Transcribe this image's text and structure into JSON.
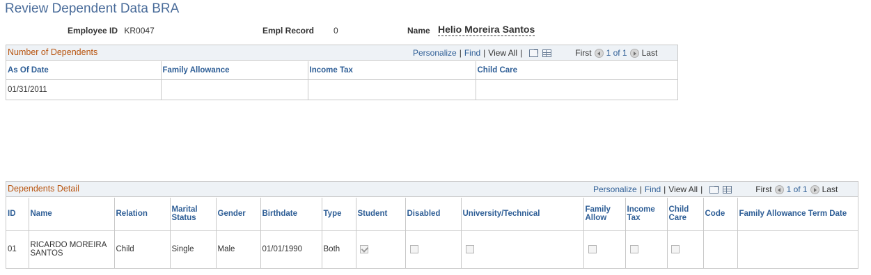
{
  "page": {
    "title": "Review Dependent Data BRA"
  },
  "header": {
    "employee_id_label": "Employee ID",
    "employee_id": "KR0047",
    "empl_record_label": "Empl Record",
    "empl_record": "0",
    "name_label": "Name",
    "name": "Helio Moreira Santos"
  },
  "dependents_count": {
    "title": "Number of Dependents",
    "nav": {
      "personalize": "Personalize",
      "find": "Find",
      "view_all": "View All",
      "first": "First",
      "range": "1 of 1",
      "last": "Last"
    },
    "columns": [
      "As Of Date",
      "Family Allowance",
      "Income Tax",
      "Child Care"
    ],
    "rows": [
      {
        "as_of_date": "01/31/2011",
        "family_allowance": "",
        "income_tax": "",
        "child_care": ""
      }
    ]
  },
  "dependents_detail": {
    "title": "Dependents Detail",
    "nav": {
      "personalize": "Personalize",
      "find": "Find",
      "view_all": "View All",
      "first": "First",
      "range": "1 of 1",
      "last": "Last"
    },
    "columns": {
      "id": "ID",
      "name": "Name",
      "relation": "Relation",
      "marital_status_1": "Marital",
      "marital_status_2": "Status",
      "gender": "Gender",
      "birthdate": "Birthdate",
      "type": "Type",
      "student": "Student",
      "disabled": "Disabled",
      "university": "University/Technical",
      "family_allow_1": "Family",
      "family_allow_2": "Allow",
      "income_tax_1": "Income",
      "income_tax_2": "Tax",
      "child_care_1": "Child",
      "child_care_2": "Care",
      "code": "Code",
      "family_allowance_term_date": "Family Allowance Term Date"
    },
    "rows": [
      {
        "id": "01",
        "name_1": "RICARDO MOREIRA",
        "name_2": "SANTOS",
        "relation": "Child",
        "marital_status": "Single",
        "gender": "Male",
        "birthdate": "01/01/1990",
        "type": "Both",
        "student": true,
        "disabled": false,
        "university": false,
        "family_allow": false,
        "income_tax": false,
        "child_care": false,
        "code": "",
        "family_allowance_term_date": ""
      }
    ]
  },
  "colors": {
    "title": "#4a6c9a",
    "link": "#2e5e96",
    "grid_title": "#b8540f",
    "grid_header_bg": "#eef2f6"
  }
}
